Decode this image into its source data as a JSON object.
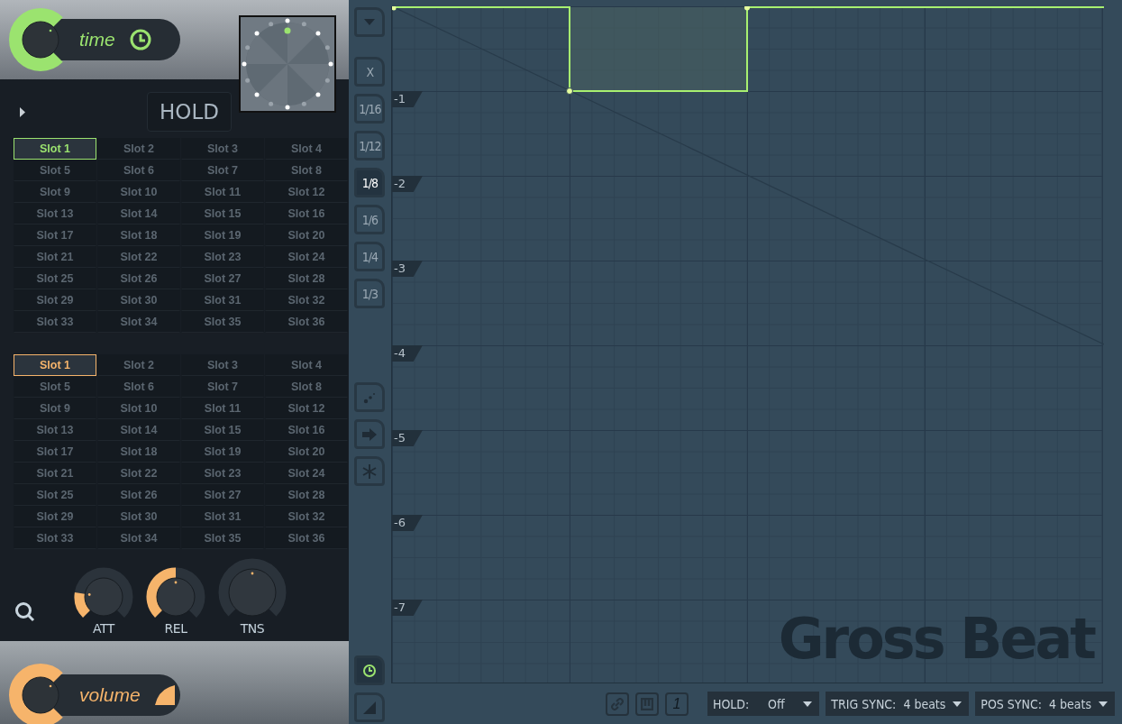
{
  "time_control": {
    "label": "time"
  },
  "hold_button": {
    "label": "HOLD"
  },
  "slot_banks": [
    {
      "kind": "time",
      "slots": [
        {
          "label": "Slot 1",
          "selected": true
        },
        {
          "label": "Slot 2",
          "selected": false
        },
        {
          "label": "Slot 3",
          "selected": false
        },
        {
          "label": "Slot 4",
          "selected": false
        },
        {
          "label": "Slot 5",
          "selected": false
        },
        {
          "label": "Slot 6",
          "selected": false
        },
        {
          "label": "Slot 7",
          "selected": false
        },
        {
          "label": "Slot 8",
          "selected": false
        },
        {
          "label": "Slot 9",
          "selected": false
        },
        {
          "label": "Slot 10",
          "selected": false
        },
        {
          "label": "Slot 11",
          "selected": false
        },
        {
          "label": "Slot 12",
          "selected": false
        },
        {
          "label": "Slot 13",
          "selected": false
        },
        {
          "label": "Slot 14",
          "selected": false
        },
        {
          "label": "Slot 15",
          "selected": false
        },
        {
          "label": "Slot 16",
          "selected": false
        },
        {
          "label": "Slot 17",
          "selected": false
        },
        {
          "label": "Slot 18",
          "selected": false
        },
        {
          "label": "Slot 19",
          "selected": false
        },
        {
          "label": "Slot 20",
          "selected": false
        },
        {
          "label": "Slot 21",
          "selected": false
        },
        {
          "label": "Slot 22",
          "selected": false
        },
        {
          "label": "Slot 23",
          "selected": false
        },
        {
          "label": "Slot 24",
          "selected": false
        },
        {
          "label": "Slot 25",
          "selected": false
        },
        {
          "label": "Slot 26",
          "selected": false
        },
        {
          "label": "Slot 27",
          "selected": false
        },
        {
          "label": "Slot 28",
          "selected": false
        },
        {
          "label": "Slot 29",
          "selected": false
        },
        {
          "label": "Slot 30",
          "selected": false
        },
        {
          "label": "Slot 31",
          "selected": false
        },
        {
          "label": "Slot 32",
          "selected": false
        },
        {
          "label": "Slot 33",
          "selected": false
        },
        {
          "label": "Slot 34",
          "selected": false
        },
        {
          "label": "Slot 35",
          "selected": false
        },
        {
          "label": "Slot 36",
          "selected": false
        }
      ]
    },
    {
      "kind": "volume",
      "slots": [
        {
          "label": "Slot 1",
          "selected": true
        },
        {
          "label": "Slot 2",
          "selected": false
        },
        {
          "label": "Slot 3",
          "selected": false
        },
        {
          "label": "Slot 4",
          "selected": false
        },
        {
          "label": "Slot 5",
          "selected": false
        },
        {
          "label": "Slot 6",
          "selected": false
        },
        {
          "label": "Slot 7",
          "selected": false
        },
        {
          "label": "Slot 8",
          "selected": false
        },
        {
          "label": "Slot 9",
          "selected": false
        },
        {
          "label": "Slot 10",
          "selected": false
        },
        {
          "label": "Slot 11",
          "selected": false
        },
        {
          "label": "Slot 12",
          "selected": false
        },
        {
          "label": "Slot 13",
          "selected": false
        },
        {
          "label": "Slot 14",
          "selected": false
        },
        {
          "label": "Slot 15",
          "selected": false
        },
        {
          "label": "Slot 16",
          "selected": false
        },
        {
          "label": "Slot 17",
          "selected": false
        },
        {
          "label": "Slot 18",
          "selected": false
        },
        {
          "label": "Slot 19",
          "selected": false
        },
        {
          "label": "Slot 20",
          "selected": false
        },
        {
          "label": "Slot 21",
          "selected": false
        },
        {
          "label": "Slot 22",
          "selected": false
        },
        {
          "label": "Slot 23",
          "selected": false
        },
        {
          "label": "Slot 24",
          "selected": false
        },
        {
          "label": "Slot 25",
          "selected": false
        },
        {
          "label": "Slot 26",
          "selected": false
        },
        {
          "label": "Slot 27",
          "selected": false
        },
        {
          "label": "Slot 28",
          "selected": false
        },
        {
          "label": "Slot 29",
          "selected": false
        },
        {
          "label": "Slot 30",
          "selected": false
        },
        {
          "label": "Slot 31",
          "selected": false
        },
        {
          "label": "Slot 32",
          "selected": false
        },
        {
          "label": "Slot 33",
          "selected": false
        },
        {
          "label": "Slot 34",
          "selected": false
        },
        {
          "label": "Slot 35",
          "selected": false
        },
        {
          "label": "Slot 36",
          "selected": false
        }
      ]
    }
  ],
  "knobs": [
    {
      "label": "ATT",
      "level": 0.2
    },
    {
      "label": "REL",
      "level": 0.5
    },
    {
      "label": "TNS"
    }
  ],
  "volume_control": {
    "label": "volume"
  },
  "toolbar": [
    {
      "kind": "dropdown",
      "selected": false
    },
    {
      "kind": "snap",
      "label": "X",
      "selected": false
    },
    {
      "kind": "snap",
      "label": "1/16",
      "selected": false
    },
    {
      "kind": "snap",
      "label": "1/12",
      "selected": false
    },
    {
      "kind": "snap",
      "label": "1/8",
      "selected": true
    },
    {
      "kind": "snap",
      "label": "1/6",
      "selected": false
    },
    {
      "kind": "snap",
      "label": "1/4",
      "selected": false
    },
    {
      "kind": "snap",
      "label": "1/3",
      "selected": false
    },
    {
      "kind": "step",
      "selected": false
    },
    {
      "kind": "arrow",
      "selected": false
    },
    {
      "kind": "freeze",
      "selected": false
    },
    {
      "kind": "clock",
      "selected": true
    },
    {
      "kind": "triangle",
      "selected": false
    }
  ],
  "grid_labels": [
    "-1",
    "-2",
    "-3",
    "-4",
    "-5",
    "-6",
    "-7"
  ],
  "logo": "Gross Beat",
  "footer": {
    "toggles": [
      {
        "kind": "link"
      },
      {
        "kind": "keyboard"
      },
      {
        "kind": "number",
        "label": "1"
      }
    ],
    "dropdowns": [
      {
        "label": "HOLD:",
        "value": "Off"
      },
      {
        "label": "TRIG SYNC:",
        "value": "4 beats"
      },
      {
        "label": "POS SYNC:",
        "value": "4 beats"
      }
    ]
  }
}
